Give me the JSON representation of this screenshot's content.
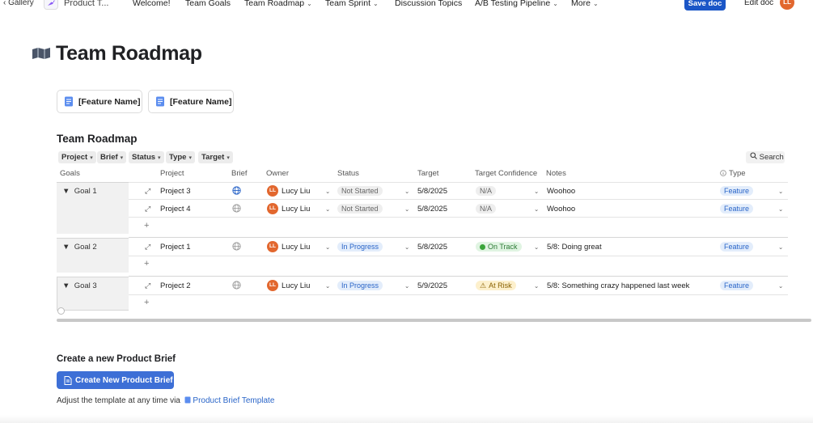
{
  "topbar": {
    "gallery_label": "‹ Gallery",
    "doc_title": "Product T...",
    "nav": [
      {
        "label": "Welcome!",
        "has_menu": false
      },
      {
        "label": "Team Goals",
        "has_menu": false
      },
      {
        "label": "Team Roadmap",
        "has_menu": true
      },
      {
        "label": "Team Sprint",
        "has_menu": true
      },
      {
        "label": "Discussion Topics",
        "has_menu": false
      },
      {
        "label": "A/B Testing Pipeline",
        "has_menu": true
      },
      {
        "label": "More",
        "has_menu": true
      }
    ],
    "save_label": "Save doc",
    "edit_label": "Edit doc",
    "avatar_initials": "LL"
  },
  "page": {
    "title": "Team Roadmap",
    "feature_cards": [
      "[Feature Name]",
      "[Feature Name]"
    ]
  },
  "table": {
    "heading": "Team Roadmap",
    "filters": [
      "Project",
      "Brief",
      "Status",
      "Type",
      "Target"
    ],
    "search_label": "Search",
    "columns": [
      "Goals",
      "Project",
      "Brief",
      "Owner",
      "Status",
      "Target",
      "Target Confidence",
      "Notes",
      "Type"
    ],
    "groups": [
      {
        "label": "Goal 1",
        "rows": [
          {
            "project": "Project 3",
            "owner": "Lucy Liu",
            "owner_initials": "LL",
            "status": "Not Started",
            "target": "5/8/2025",
            "confidence": "N/A",
            "notes": "Woohoo",
            "type": "Feature"
          },
          {
            "project": "Project 4",
            "owner": "Lucy Liu",
            "owner_initials": "LL",
            "status": "Not Started",
            "target": "5/8/2025",
            "confidence": "N/A",
            "notes": "Woohoo",
            "type": "Feature"
          }
        ]
      },
      {
        "label": "Goal 2",
        "rows": [
          {
            "project": "Project 1",
            "owner": "Lucy Liu",
            "owner_initials": "LL",
            "status": "In Progress",
            "target": "5/8/2025",
            "confidence": "On Track",
            "notes": "5/8: Doing great",
            "type": "Feature"
          }
        ]
      },
      {
        "label": "Goal 3",
        "rows": [
          {
            "project": "Project 2",
            "owner": "Lucy Liu",
            "owner_initials": "LL",
            "status": "In Progress",
            "target": "5/9/2025",
            "confidence": "At Risk",
            "notes": "5/8: Something crazy happened last week",
            "type": "Feature"
          }
        ]
      }
    ],
    "add_row": "+"
  },
  "brief": {
    "heading": "Create a new Product Brief",
    "button_label": "Create New Product Brief",
    "adjust_text": "Adjust the template at any time via",
    "template_link": "Product Brief Template"
  },
  "colors": {
    "accent": "#1b56c7",
    "create_button": "#3d6fd6",
    "avatar": "#e2672e",
    "in_progress": "#2a65c8",
    "on_track": "#2d7b36",
    "at_risk": "#8a6100"
  }
}
